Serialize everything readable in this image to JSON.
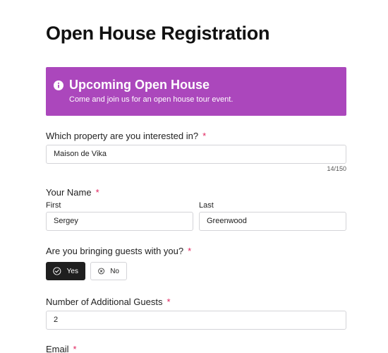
{
  "page": {
    "title": "Open House Registration"
  },
  "banner": {
    "icon": "info-icon",
    "title": "Upcoming Open House",
    "subtitle": "Come and join us for an open house tour event.",
    "color": "#ab47bc"
  },
  "property": {
    "label": "Which property are you interested in?",
    "required": "*",
    "value": "Maison de Vika",
    "counter": "14/150"
  },
  "name": {
    "label": "Your Name",
    "required": "*",
    "first_label": "First",
    "first_value": "Sergey",
    "last_label": "Last",
    "last_value": "Greenwood"
  },
  "guests": {
    "label": "Are you bringing guests with you?",
    "required": "*",
    "yes_label": "Yes",
    "no_label": "No",
    "selected": "Yes"
  },
  "additional": {
    "label": "Number of Additional Guests",
    "required": "*",
    "value": "2"
  },
  "email": {
    "label": "Email",
    "required": "*"
  }
}
